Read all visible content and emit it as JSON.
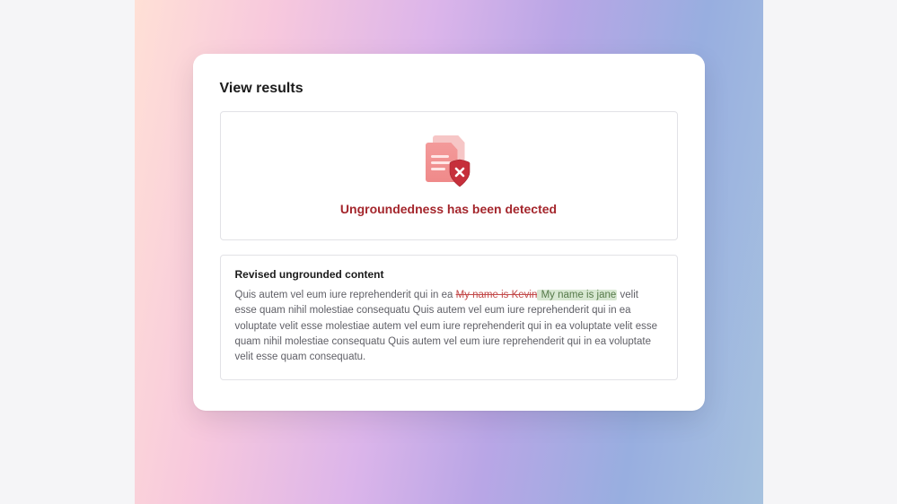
{
  "card": {
    "title": "View results"
  },
  "detection": {
    "message": "Ungroundedness has been detected"
  },
  "revised": {
    "title": "Revised ungrounded content",
    "text_before": "Quis autem vel eum iure reprehenderit qui in ea ",
    "removed": "My name is Kevin",
    "added": " My name is jane",
    "text_after": " velit esse quam nihil molestiae consequatu Quis autem vel eum iure reprehenderit qui in ea voluptate velit esse molestiae  autem vel eum iure reprehenderit qui in ea voluptate velit esse quam nihil molestiae consequatu Quis autem vel eum iure reprehenderit qui in ea voluptate velit esse quam consequatu."
  },
  "icons": {
    "status": "document-shield-error-icon"
  }
}
